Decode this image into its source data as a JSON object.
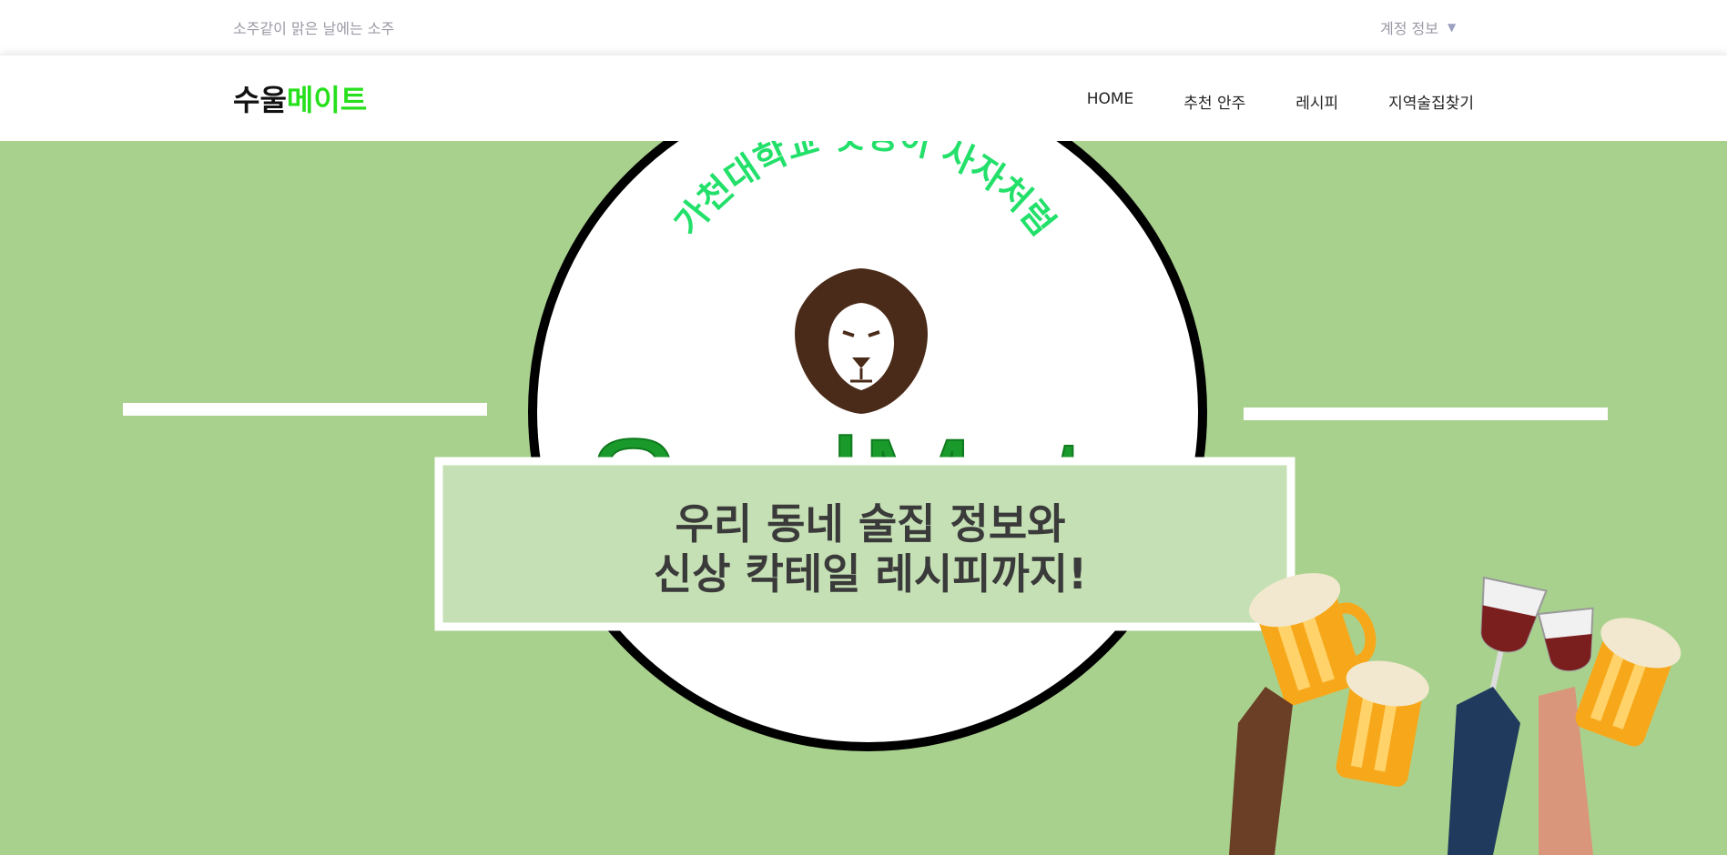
{
  "topbar": {
    "tagline": "소주같이 맑은 날에는 소주",
    "account_label": "계정 정보"
  },
  "logo": {
    "part1": "수울",
    "part2": "메이트"
  },
  "nav": {
    "items": [
      {
        "label": "HOME"
      },
      {
        "label": "추천 안주"
      },
      {
        "label": "레시피"
      },
      {
        "label": "지역술집찾기"
      }
    ]
  },
  "hero": {
    "arc_text": "가천대학교 멋쟁이 사자처럼",
    "brand": "SoolMate",
    "banner_line1": "우리 동네 술집 정보와",
    "banner_line2": "신상 칵테일 레시피까지!"
  },
  "colors": {
    "background_green": "#a9d18e",
    "accent_green": "#26e01b",
    "brand_green": "#1a9a2a"
  }
}
